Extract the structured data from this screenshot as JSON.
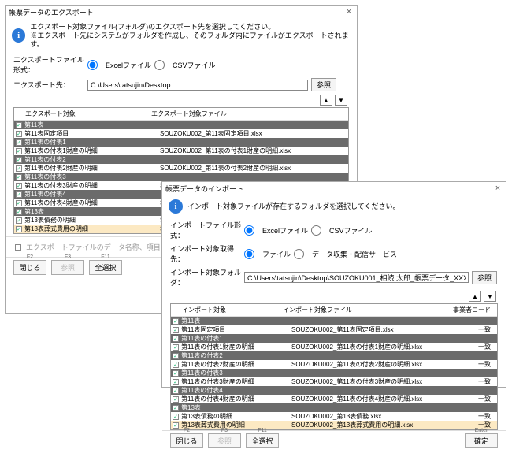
{
  "dlg1": {
    "title": "帳票データのエクスポート",
    "close": "×",
    "instr1": "エクスポート対象ファイル(フォルダ)のエクスポート先を選択してください。",
    "instr2": "※エクスポート先にシステムがフォルダを作成し、そのフォルダ内にファイルがエクスポートされます。",
    "fmt_label": "エクスポートファイル形式：",
    "opt_excel": "Excelファイル",
    "opt_csv": "CSVファイル",
    "dest_label": "エクスポート先：",
    "dest_value": "C:\\Users\\tatsujin\\Desktop",
    "ref": "参照",
    "head1": "エクスポート対象",
    "head2": "エクスポート対象ファイル",
    "footer_check": "エクスポートファイルのデータ名称、項目名をコードに変換する",
    "rows": [
      {
        "dark": true,
        "chk": true,
        "c1": "第11表",
        "c2": ""
      },
      {
        "dark": false,
        "chk": true,
        "c1": "第11表固定項目",
        "c2": "SOUZOKU002_第11表固定項目.xlsx"
      },
      {
        "dark": true,
        "chk": true,
        "c1": "第11表の付表1",
        "c2": ""
      },
      {
        "dark": false,
        "chk": true,
        "c1": "第11表の付表1財産の明細",
        "c2": "SOUZOKU002_第11表の付表1財産の明細.xlsx"
      },
      {
        "dark": true,
        "chk": true,
        "c1": "第11表の付表2",
        "c2": ""
      },
      {
        "dark": false,
        "chk": true,
        "c1": "第11表の付表2財産の明細",
        "c2": "SOUZOKU002_第11表の付表2財産の明細.xlsx"
      },
      {
        "dark": true,
        "chk": true,
        "c1": "第11表の付表3",
        "c2": ""
      },
      {
        "dark": false,
        "chk": true,
        "c1": "第11表の付表3財産の明細",
        "c2": "SOUZOKU002_第11表の付表3財産の明細.xlsx"
      },
      {
        "dark": true,
        "chk": true,
        "c1": "第11表の付表4",
        "c2": ""
      },
      {
        "dark": false,
        "chk": true,
        "c1": "第11表の付表4財産の明細",
        "c2": "SOUZOKU002_第11表の付表4財産の明細.xlsx"
      },
      {
        "dark": true,
        "chk": true,
        "c1": "第13表",
        "c2": ""
      },
      {
        "dark": false,
        "chk": true,
        "c1": "第13表債務の明細",
        "c2": "SOUZOKU002_第13表債務.xlsx"
      },
      {
        "dark": false,
        "chk": true,
        "sel": true,
        "c1": "第13表葬式費用の明細",
        "c2": "SOUZOKU002_第"
      }
    ],
    "buttons": {
      "close": "閉じる",
      "close_key": "F2",
      "ref": "参照",
      "ref_key": "F3",
      "all": "全選択",
      "all_key": "F11"
    }
  },
  "dlg2": {
    "title": "帳票データのインポート",
    "close": "×",
    "instr": "インポート対象ファイルが存在するフォルダを選択してください。",
    "fmt_label": "インポートファイル形式：",
    "opt_excel": "Excelファイル",
    "opt_csv": "CSVファイル",
    "from_label": "インポート対象取得先：",
    "opt_file": "ファイル",
    "opt_svc": "データ収集・配信サービス",
    "folder_label": "インポート対象フォルダ：",
    "folder_value": "C:\\Users\\tatsujin\\Desktop\\SOUZOKU001_相続 太郎_帳票データ_XXXXXXXX",
    "ref": "参照",
    "head1": "インポート対象",
    "head2": "インポート対象ファイル",
    "head3": "事業者コード",
    "match": "一致",
    "rows": [
      {
        "dark": true,
        "chk": true,
        "c1": "第11表",
        "c2": "",
        "c3": ""
      },
      {
        "dark": false,
        "chk": true,
        "c1": "第11表固定項目",
        "c2": "SOUZOKU002_第11表固定項目.xlsx",
        "c3": "一致"
      },
      {
        "dark": true,
        "chk": true,
        "c1": "第11表の付表1",
        "c2": "",
        "c3": ""
      },
      {
        "dark": false,
        "chk": true,
        "c1": "第11表の付表1財産の明細",
        "c2": "SOUZOKU002_第11表の付表1財産の明細.xlsx",
        "c3": "一致"
      },
      {
        "dark": true,
        "chk": true,
        "c1": "第11表の付表2",
        "c2": "",
        "c3": ""
      },
      {
        "dark": false,
        "chk": true,
        "c1": "第11表の付表2財産の明細",
        "c2": "SOUZOKU002_第11表の付表2財産の明細.xlsx",
        "c3": "一致"
      },
      {
        "dark": true,
        "chk": true,
        "c1": "第11表の付表3",
        "c2": "",
        "c3": ""
      },
      {
        "dark": false,
        "chk": true,
        "c1": "第11表の付表3財産の明細",
        "c2": "SOUZOKU002_第11表の付表3財産の明細.xlsx",
        "c3": "一致"
      },
      {
        "dark": true,
        "chk": true,
        "c1": "第11表の付表4",
        "c2": "",
        "c3": ""
      },
      {
        "dark": false,
        "chk": true,
        "c1": "第11表の付表4財産の明細",
        "c2": "SOUZOKU002_第11表の付表4財産の明細.xlsx",
        "c3": "一致"
      },
      {
        "dark": true,
        "chk": true,
        "c1": "第13表",
        "c2": "",
        "c3": ""
      },
      {
        "dark": false,
        "chk": true,
        "c1": "第13表債務の明細",
        "c2": "SOUZOKU002_第13表債務.xlsx",
        "c3": "一致"
      },
      {
        "dark": false,
        "chk": true,
        "sel": true,
        "c1": "第13表葬式費用の明細",
        "c2": "SOUZOKU002_第13表葬式費用の明細.xlsx",
        "c3": "一致"
      }
    ],
    "buttons": {
      "close": "閉じる",
      "close_key": "F2",
      "ref": "参照",
      "ref_key": "F3",
      "all": "全選択",
      "all_key": "F11",
      "ok": "確定",
      "ok_key": "Enter"
    }
  }
}
